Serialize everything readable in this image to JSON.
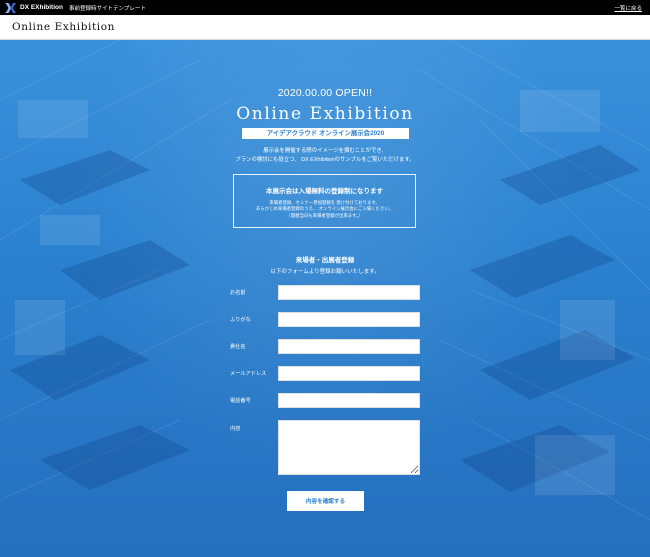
{
  "topbar": {
    "brand": "DX EXhibition",
    "subtitle": "事前登録時サイトテンプレート",
    "back_link": "一覧に戻る",
    "logo_icon": "dx-logo-icon"
  },
  "header": {
    "title": "Online Exhibition"
  },
  "hero": {
    "open": "2020.00.00 OPEN!!",
    "title": "Online Exhibition",
    "subtitle": "アイデアクラウド オンライン展示会2020",
    "lead_1": "展示会を開催する際のイメージを掴むことができ、",
    "lead_2": "プランの検討にも役立つ、 DX EXhibitionのサンプルをご覧いただけます。"
  },
  "notice": {
    "title": "本展示会は入場無料の登録制になります",
    "line_1": "来場者登録、セミナー参加登録を 受け付けております。",
    "line_2": "あらかじめ来場者登録のうえ、 オンライン展示会にご入場ください。",
    "line_3": "（開催当日も来場者登録が出来ます。）"
  },
  "registration": {
    "title": "来場者・出展者登録",
    "subtitle": "以下のフォームより登録お願いいたします。",
    "fields": [
      {
        "label": "お名前",
        "value": ""
      },
      {
        "label": "ふりがな",
        "value": ""
      },
      {
        "label": "貴社名",
        "value": ""
      },
      {
        "label": "メールアドレス",
        "value": ""
      },
      {
        "label": "電話番号",
        "value": ""
      },
      {
        "label": "内容",
        "value": ""
      }
    ],
    "submit": "内容を確認する"
  },
  "colors": {
    "accent": "#2b7fcf",
    "background": "#2b84d4",
    "topbar": "#000000"
  }
}
